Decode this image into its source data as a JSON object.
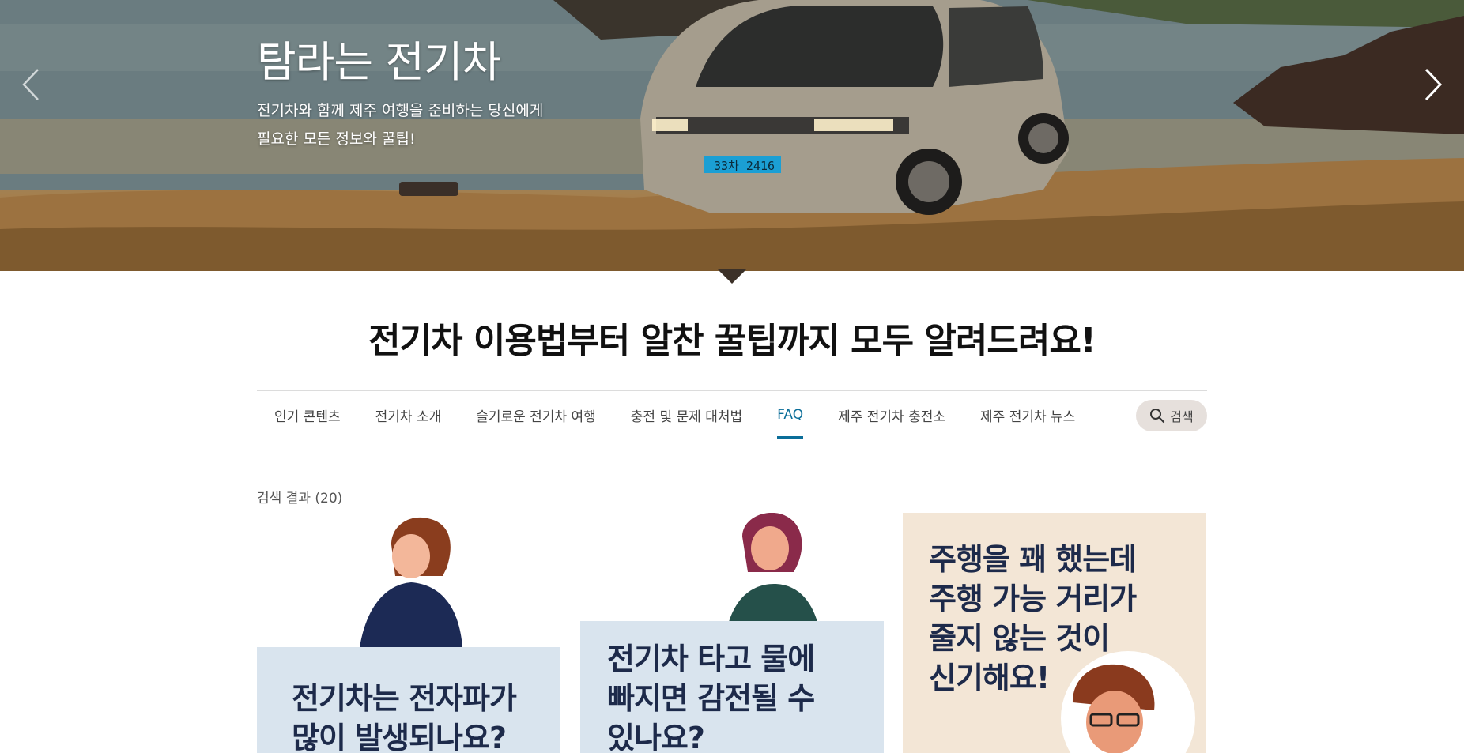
{
  "hero": {
    "title": "탐라는 전기차",
    "subtitle_line1": "전기차와 함께 제주 여행을 준비하는 당신에게",
    "subtitle_line2": "필요한 모든 정보와 꿀팁!",
    "license_plate": "33차 2416",
    "prev_icon": "chevron-left-icon",
    "next_icon": "chevron-right-icon"
  },
  "headline": "전기차 이용법부터 알찬 꿀팁까지 모두 알려드려요!",
  "nav": {
    "items": [
      {
        "label": "인기 콘텐츠"
      },
      {
        "label": "전기차 소개"
      },
      {
        "label": "슬기로운 전기차 여행"
      },
      {
        "label": "충전 및 문제 대처법"
      },
      {
        "label": "FAQ",
        "active": true
      },
      {
        "label": "제주 전기차 충전소"
      },
      {
        "label": "제주 전기차 뉴스"
      }
    ],
    "search_label": "검색",
    "accent_color": "#0b6e99"
  },
  "results": {
    "count_label": "검색 결과 (20)"
  },
  "cards": [
    {
      "line1": "전기차는 전자파가",
      "line2": "많이 발생되나요?"
    },
    {
      "line1": "전기차 타고 물에",
      "line2": "빠지면 감전될 수",
      "line3": "있나요?"
    },
    {
      "line1": "주행을 꽤 했는데",
      "line2": "주행 가능 거리가",
      "line3": "줄지 않는 것이",
      "line4": "신기해요!"
    }
  ]
}
